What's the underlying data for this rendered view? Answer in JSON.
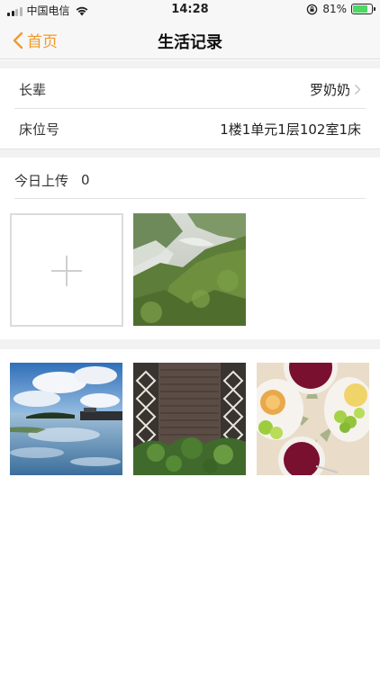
{
  "status_bar": {
    "carrier": "中国电信",
    "time": "14:28",
    "battery_percent": "81%",
    "battery_level": 0.81
  },
  "nav": {
    "back_label": "首页",
    "title": "生活记录",
    "accent_color": "#f09a2a"
  },
  "info": {
    "elder_label": "长辈",
    "elder_value": "罗奶奶",
    "bed_label": "床位号",
    "bed_value": "1楼1单元1层102室1床"
  },
  "today": {
    "label": "今日上传",
    "count": "0"
  },
  "icons": [
    "signal-icon",
    "wifi-icon",
    "rotation-lock-icon",
    "battery-icon",
    "back-chevron-icon",
    "chevron-right-icon",
    "plus-icon"
  ],
  "photos_today": [
    "misty-mountain-photo"
  ],
  "photos_history": [
    "lake-sky-photo",
    "garden-wall-photo",
    "breakfast-table-photo"
  ]
}
